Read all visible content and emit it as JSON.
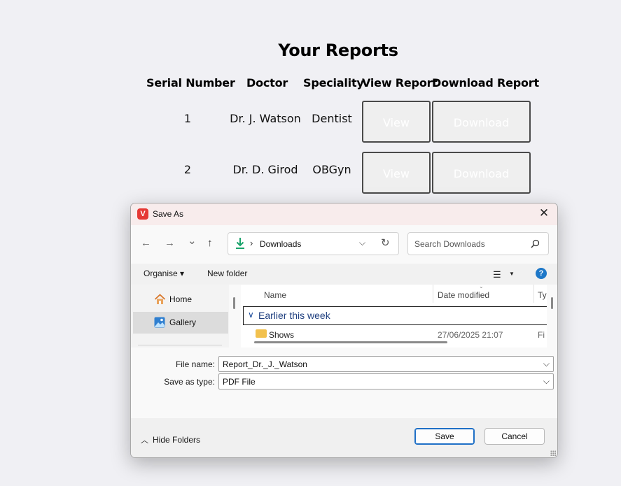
{
  "page": {
    "title": "Your Reports",
    "columns": [
      "Serial Number",
      "Doctor",
      "Speciality",
      "View Report",
      "Download Report"
    ],
    "rows": [
      {
        "serial": "1",
        "doctor": "Dr. J. Watson",
        "speciality": "Dentist",
        "view_label": "View",
        "download_label": "Download"
      },
      {
        "serial": "2",
        "doctor": "Dr. D. Girod",
        "speciality": "OBGyn",
        "view_label": "View",
        "download_label": "Download"
      }
    ]
  },
  "dialog": {
    "title": "Save As",
    "close_glyph": "✕",
    "nav": {
      "back": "←",
      "forward": "→",
      "recent": "⌄",
      "up": "↑"
    },
    "address": {
      "separator": "›",
      "location": "Downloads"
    },
    "search": {
      "placeholder": "Search Downloads"
    },
    "commands": {
      "organise": "Organise ▾",
      "new_folder": "New folder",
      "help": "?"
    },
    "navigation_pane": [
      {
        "label": "Home",
        "icon": "home-icon",
        "selected": false
      },
      {
        "label": "Gallery",
        "icon": "gallery-icon",
        "selected": true
      }
    ],
    "file_list": {
      "columns": [
        "Name",
        "Date modified",
        "Ty"
      ],
      "group": "Earlier this week",
      "rows": [
        {
          "name": "Shows",
          "date": "27/06/2025 21:07",
          "type": "Fi"
        }
      ]
    },
    "form": {
      "file_name_label": "File name:",
      "file_name_value": "Report_Dr._J._Watson",
      "save_type_label": "Save as type:",
      "save_type_value": "PDF File"
    },
    "footer": {
      "hide_folders": "Hide Folders",
      "save": "Save",
      "cancel": "Cancel"
    }
  },
  "colors": {
    "dialog_title_bg": "#f8ecec",
    "accent": "#1e6fc6",
    "download_icon": "#1aa36b"
  }
}
